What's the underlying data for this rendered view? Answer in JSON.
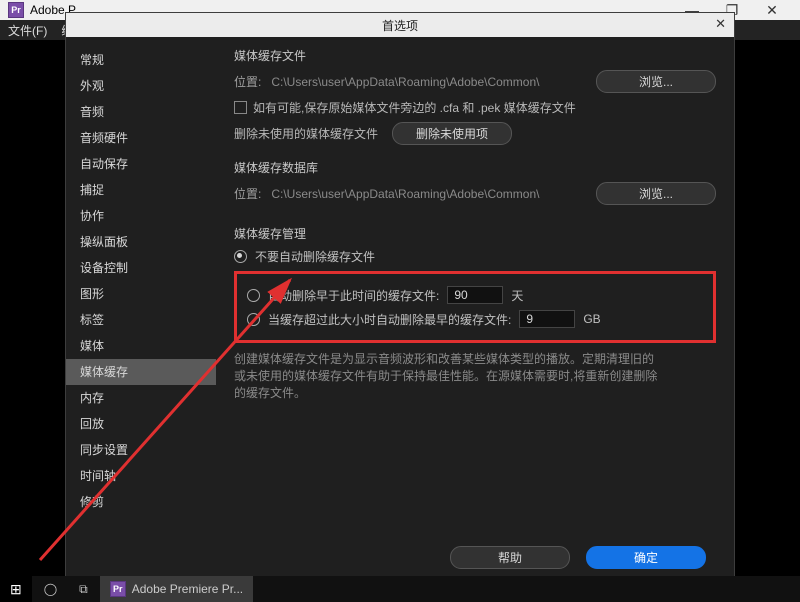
{
  "windowTitle": "Adobe P",
  "menu": {
    "file": "文件(F)",
    "edit": "编辑"
  },
  "winControls": {
    "min": "—",
    "max": "❐",
    "close": "✕"
  },
  "dialog": {
    "title": "首选项",
    "close": "✕",
    "sidebar": [
      "常规",
      "外观",
      "音频",
      "音频硬件",
      "自动保存",
      "捕捉",
      "协作",
      "操纵面板",
      "设备控制",
      "图形",
      "标签",
      "媒体",
      "媒体缓存",
      "内存",
      "回放",
      "同步设置",
      "时间轴",
      "修剪"
    ],
    "selectedIndex": 12,
    "cacheFiles": {
      "title": "媒体缓存文件",
      "locLabel": "位置:",
      "path": "C:\\Users\\user\\AppData\\Roaming\\Adobe\\Common\\",
      "browse": "浏览...",
      "saveCopies": "如有可能,保存原始媒体文件旁边的 .cfa 和 .pek 媒体缓存文件",
      "deleteUnusedLabel": "删除未使用的媒体缓存文件",
      "deleteUnusedBtn": "删除未使用项"
    },
    "cacheDb": {
      "title": "媒体缓存数据库",
      "locLabel": "位置:",
      "path": "C:\\Users\\user\\AppData\\Roaming\\Adobe\\Common\\",
      "browse": "浏览..."
    },
    "mgmt": {
      "title": "媒体缓存管理",
      "optNone": "不要自动删除缓存文件",
      "optAge": "自动删除早于此时间的缓存文件:",
      "ageValue": "90",
      "ageUnit": "天",
      "optSize": "当缓存超过此大小时自动删除最早的缓存文件:",
      "sizeValue": "9",
      "sizeUnit": "GB",
      "desc": "创建媒体缓存文件是为显示音频波形和改善某些媒体类型的播放。定期清理旧的或未使用的媒体缓存文件有助于保持最佳性能。在源媒体需要时,将重新创建删除的缓存文件。"
    },
    "footer": {
      "help": "帮助",
      "ok": "确定"
    }
  },
  "taskbar": {
    "start": "⊞",
    "cortana": "◯",
    "taskview": "⧉",
    "app": "Adobe Premiere Pr..."
  }
}
